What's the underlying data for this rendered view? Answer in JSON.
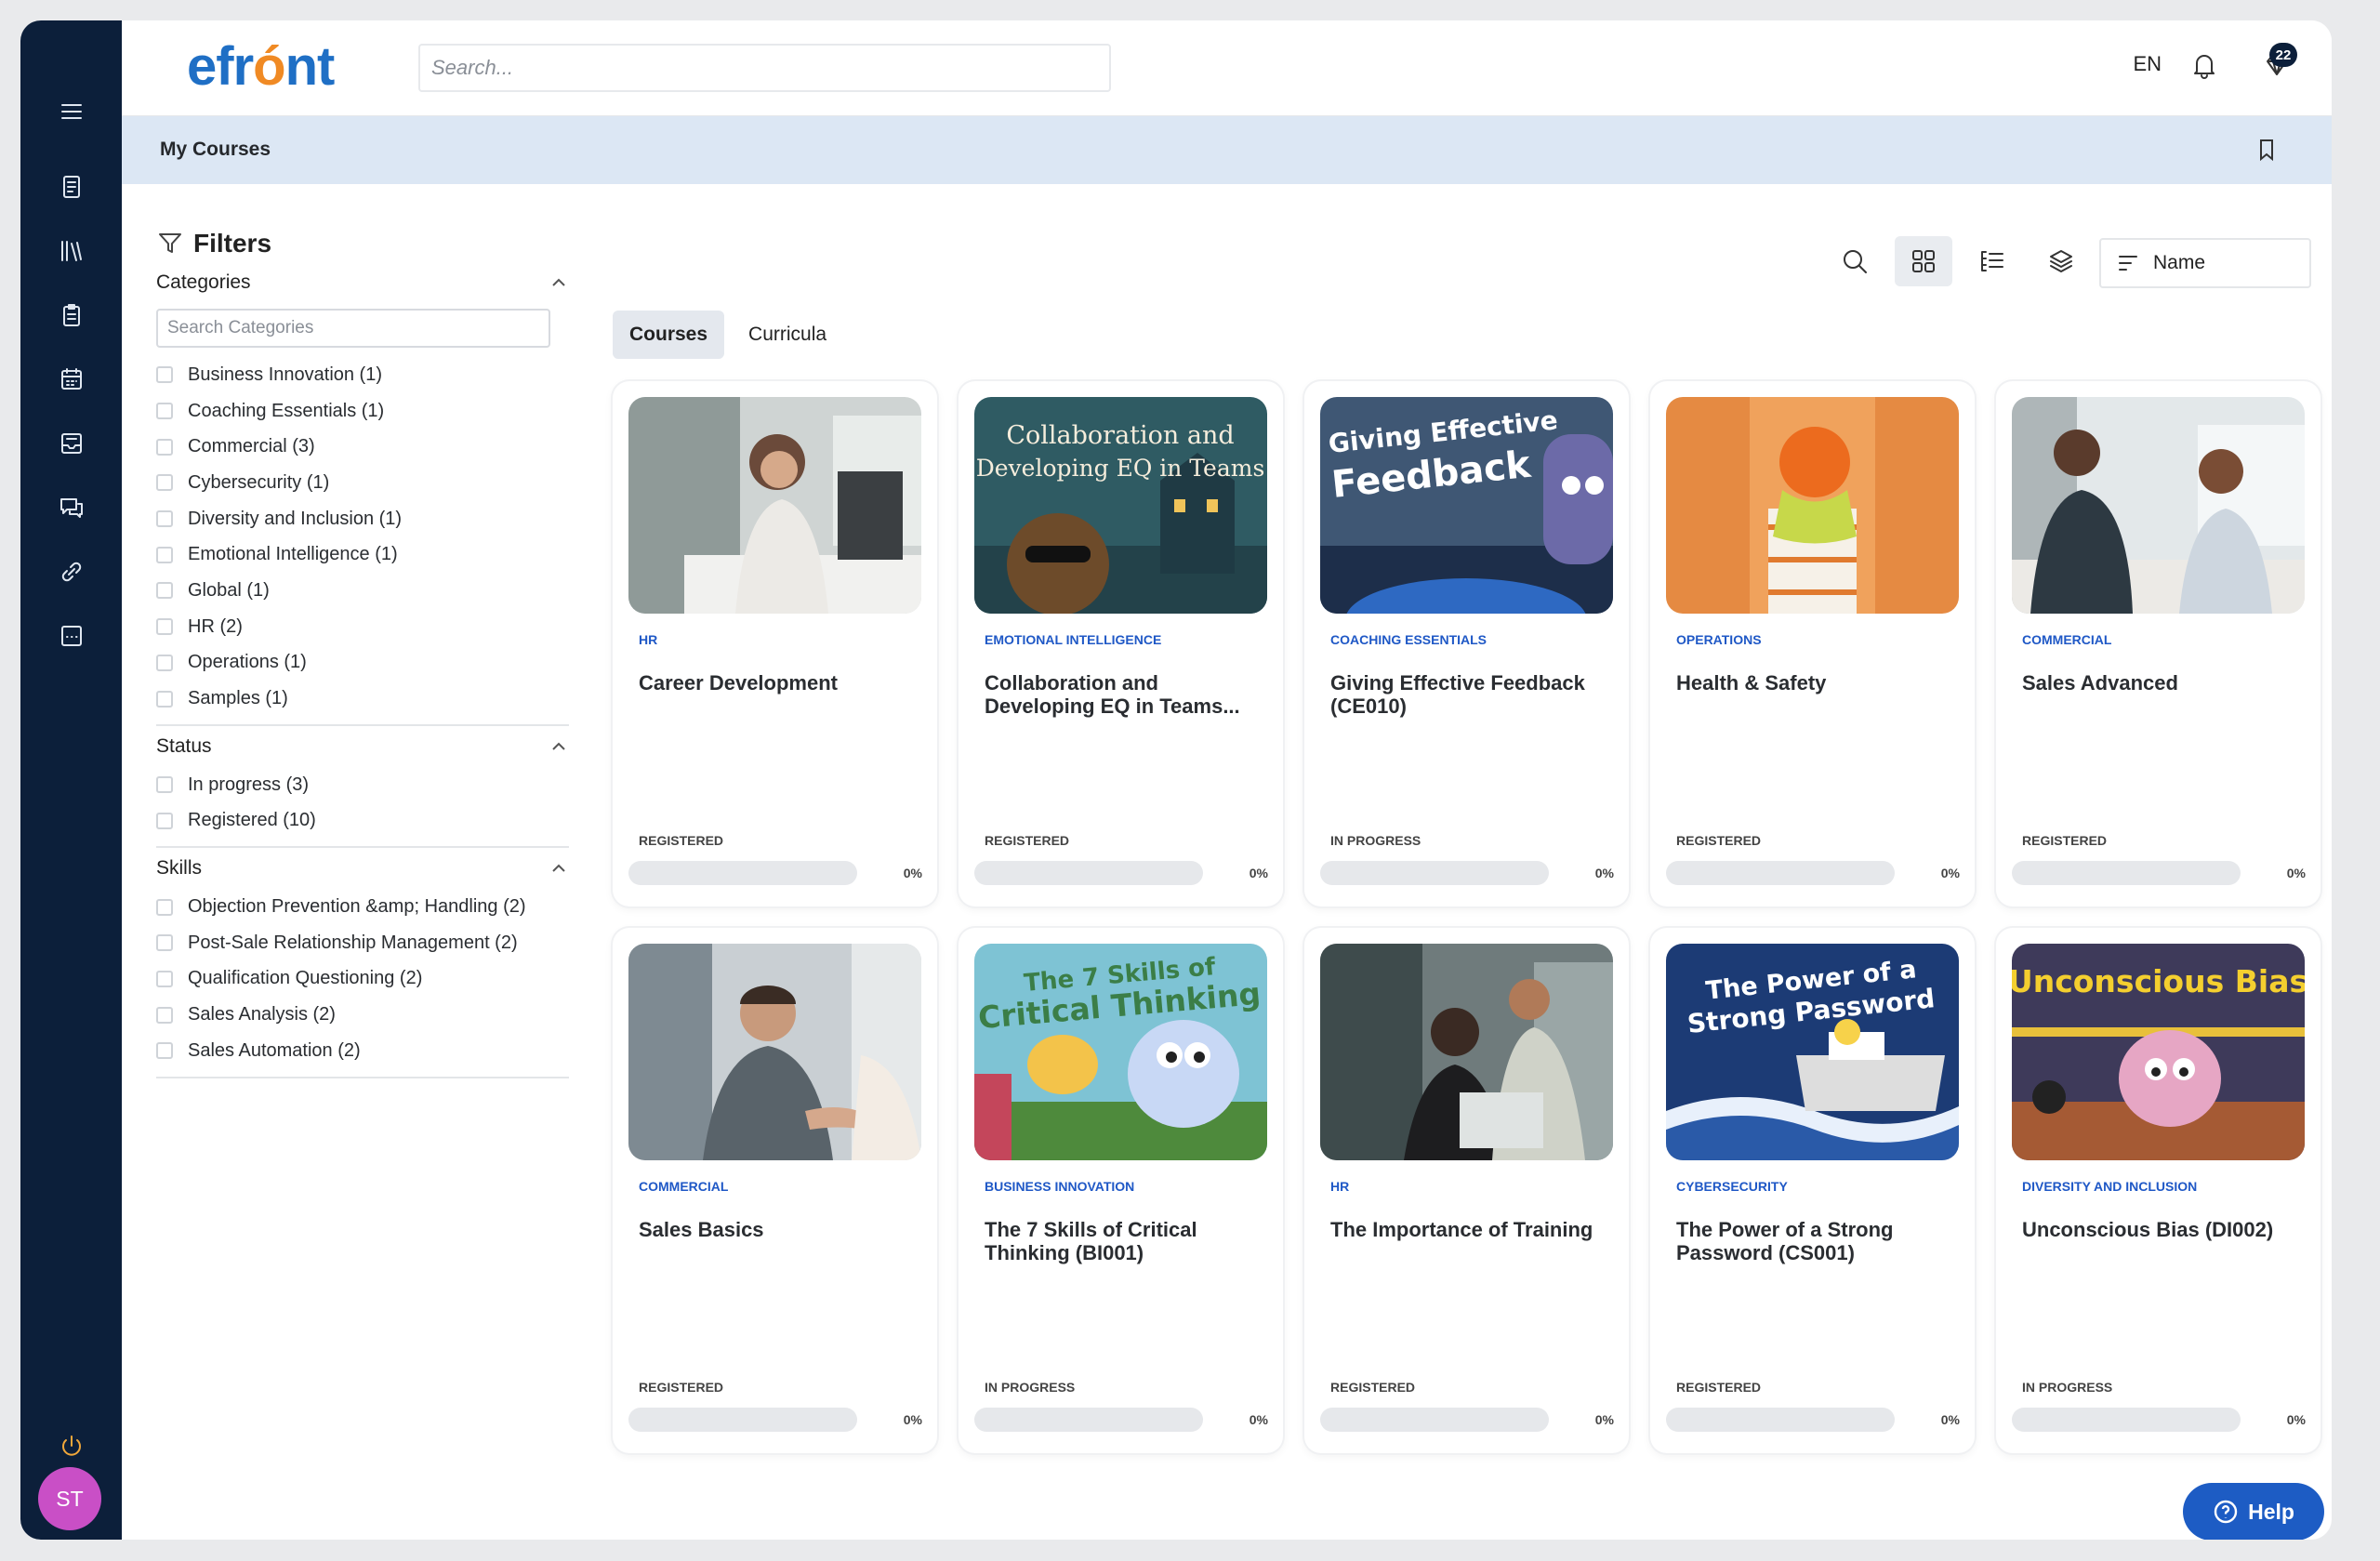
{
  "app": {
    "logo": "efront",
    "page_title": "My Courses"
  },
  "header": {
    "search_placeholder": "Search...",
    "language": "EN",
    "notification_badge": "22"
  },
  "filters": {
    "title": "Filters",
    "categories": {
      "label": "Categories",
      "search_placeholder": "Search Categories",
      "items": [
        "Business Innovation (1)",
        "Coaching Essentials (1)",
        "Commercial (3)",
        "Cybersecurity (1)",
        "Diversity and Inclusion (1)",
        "Emotional Intelligence (1)",
        "Global (1)",
        "HR (2)",
        "Operations (1)",
        "Samples (1)"
      ]
    },
    "status": {
      "label": "Status",
      "items": [
        "In progress (3)",
        "Registered (10)"
      ]
    },
    "skills": {
      "label": "Skills",
      "items": [
        "Objection Prevention &amp; Handling (2)",
        "Post-Sale Relationship Management (2)",
        "Qualification Questioning (2)",
        "Sales Analysis (2)",
        "Sales Automation (2)"
      ]
    }
  },
  "toolbar": {
    "sort_label": "Name"
  },
  "tabs": [
    "Courses",
    "Curricula"
  ],
  "courses": [
    {
      "category": "HR",
      "title": "Career Development",
      "status": "REGISTERED",
      "progress": "0%"
    },
    {
      "category": "EMOTIONAL INTELLIGENCE",
      "title": "Collaboration and Developing EQ in Teams...",
      "status": "REGISTERED",
      "progress": "0%"
    },
    {
      "category": "COACHING ESSENTIALS",
      "title": "Giving Effective Feedback (CE010)",
      "status": "IN PROGRESS",
      "progress": "0%"
    },
    {
      "category": "OPERATIONS",
      "title": "Health & Safety",
      "status": "REGISTERED",
      "progress": "0%"
    },
    {
      "category": "COMMERCIAL",
      "title": "Sales Advanced",
      "status": "REGISTERED",
      "progress": "0%"
    },
    {
      "category": "COMMERCIAL",
      "title": "Sales Basics",
      "status": "REGISTERED",
      "progress": "0%"
    },
    {
      "category": "BUSINESS INNOVATION",
      "title": "The 7 Skills of Critical Thinking (BI001)",
      "status": "IN PROGRESS",
      "progress": "0%"
    },
    {
      "category": "HR",
      "title": "The Importance of Training",
      "status": "REGISTERED",
      "progress": "0%"
    },
    {
      "category": "CYBERSECURITY",
      "title": "The Power of a Strong Password (CS001)",
      "status": "REGISTERED",
      "progress": "0%"
    },
    {
      "category": "DIVERSITY AND INCLUSION",
      "title": "Unconscious Bias (DI002)",
      "status": "IN PROGRESS",
      "progress": "0%"
    }
  ],
  "thumb_text": {
    "t1": "Collaboration and",
    "t1b": "Developing EQ in Teams",
    "t2": "Giving Effective",
    "t2b": "Feedback",
    "t6": "The 7 Skills of",
    "t6b": "Critical Thinking",
    "t8": "The Power of a",
    "t8b": "Strong Password",
    "t9": "Unconscious Bias"
  },
  "user": {
    "initials": "ST"
  },
  "help": {
    "label": "Help"
  },
  "colors": {
    "sidebar": "#0c1f3a",
    "accent": "#1f58c6",
    "subheader": "#dce7f4",
    "avatar": "#c94fc6",
    "help_button": "#1d5cc4"
  }
}
